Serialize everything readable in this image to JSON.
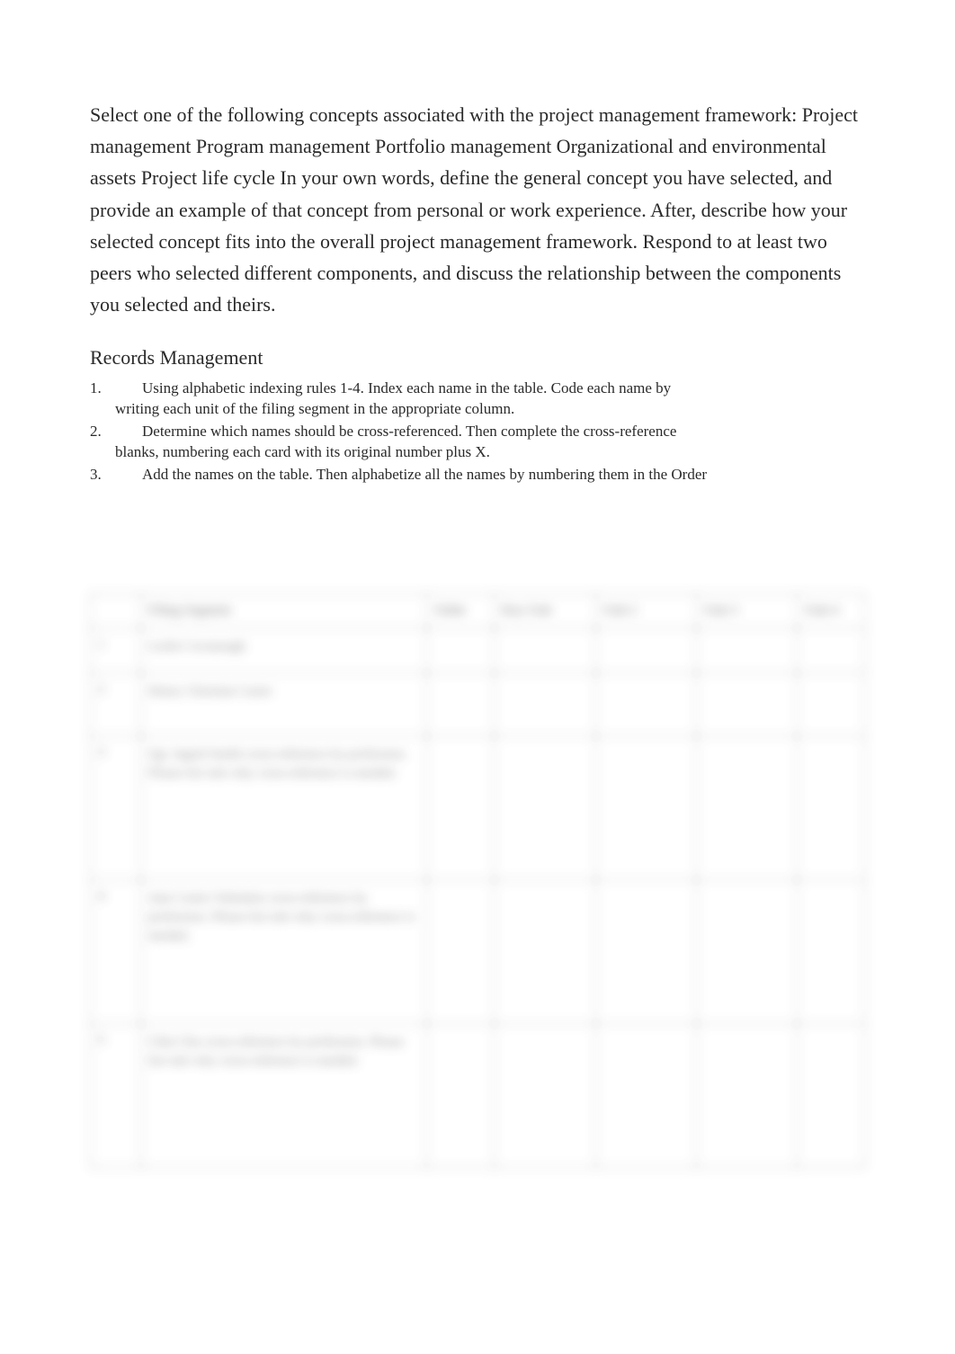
{
  "main_paragraph": "Select one of the following concepts associated with the project management framework: Project management Program management Portfolio management Organizational and environmental assets Project life cycle In your own words, define the general concept you have selected, and provide an example of that concept from personal or work experience. After, describe how your selected concept fits into the overall project management framework. Respond to at least two peers who selected different components, and discuss the relationship between the components you selected and theirs.",
  "subheading": "Records Management",
  "list": [
    {
      "num": "1.",
      "line1": "Using alphabetic indexing rules 1-4. Index each name in the table. Code each name by",
      "line2": "writing each unit of the filing segment in the appropriate column."
    },
    {
      "num": "2.",
      "line1": "Determine which names should be cross-referenced. Then complete the cross-reference",
      "line2": "blanks, numbering each card with its original number plus X."
    },
    {
      "num": "3.",
      "line1": "Add the names on the table. Then alphabetize all the names by numbering them in the Order",
      "line2": ""
    }
  ],
  "blurred_table": {
    "headers": [
      "",
      "Filing Segment",
      "Order",
      "Key Unit",
      "Unit 2",
      "Unit 3",
      "Unit 4"
    ],
    "rows": [
      {
        "num": "1",
        "seg": "Leslie Cavanaugh"
      },
      {
        "num": "2",
        "seg": "Henry Christian Carter"
      },
      {
        "num": "3",
        "seg": "Sgt. Ingrid Smith cross-reference by profession. Please list rule why cross-reference is needed."
      },
      {
        "num": "4",
        "seg": "Jane Carter-Valentine cross-reference by profession. Please list rule why cross-reference is needed."
      },
      {
        "num": "5",
        "seg": "Chin Chu cross-reference by profession. Please list rule why cross-reference is needed."
      }
    ]
  }
}
